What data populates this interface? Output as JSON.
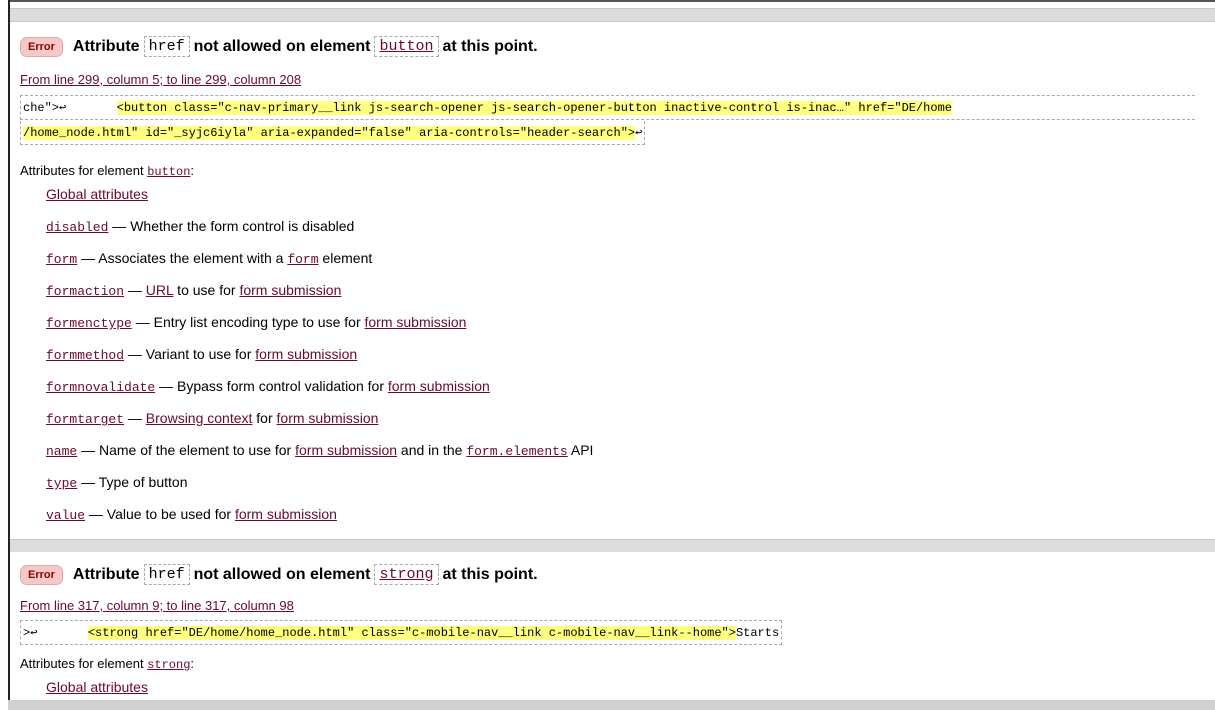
{
  "messages": [
    {
      "badge": "Error",
      "title_pre": "Attribute",
      "attr": "href",
      "title_mid": "not allowed on element",
      "element": "button",
      "title_post": "at this point.",
      "location": "From line 299, column 5; to line 299, column 208",
      "extract_line1_prefix": "che\">↩       ",
      "extract_line1_hl": "<button class=\"c-nav-primary__link js-search-opener js-search-opener-button inactive-control is-inac…\" href=\"DE/home",
      "extract_line2_hl": "/home_node.html\" id=\"_syjc6iyla\" aria-expanded=\"false\" aria-controls=\"header-search\">",
      "extract_line2_suffix": "↩",
      "attrs_heading": "Attributes for element",
      "attrs_element": "button",
      "attrs_heading_suffix": ":",
      "global_attrs": "Global attributes",
      "rows": [
        {
          "name": "disabled",
          "desc1": " — Whether the form control is disabled"
        },
        {
          "name": "form",
          "desc1": " — Associates the element with a ",
          "code": "form",
          "desc2": " element"
        },
        {
          "name": "formaction",
          "desc1": " — ",
          "link1": "URL",
          "desc2": " to use for ",
          "link2": "form submission"
        },
        {
          "name": "formenctype",
          "desc1": " — Entry list encoding type to use for ",
          "link1": "form submission"
        },
        {
          "name": "formmethod",
          "desc1": " — Variant to use for ",
          "link1": "form submission"
        },
        {
          "name": "formnovalidate",
          "desc1": " — Bypass form control validation for ",
          "link1": "form submission"
        },
        {
          "name": "formtarget",
          "desc1": " — ",
          "link1": "Browsing context",
          "desc2": " for ",
          "link2": "form submission"
        },
        {
          "name": "name",
          "desc1": " — Name of the element to use for ",
          "link1": "form submission",
          "desc2": " and in the ",
          "code": "form.elements",
          "desc3": " API"
        },
        {
          "name": "type",
          "desc1": " — Type of button"
        },
        {
          "name": "value",
          "desc1": " — Value to be used for ",
          "link1": "form submission"
        }
      ]
    },
    {
      "badge": "Error",
      "title_pre": "Attribute",
      "attr": "href",
      "title_mid": "not allowed on element",
      "element": "strong",
      "title_post": "at this point.",
      "location": "From line 317, column 9; to line 317, column 98",
      "extract_line1_prefix": ">↩       ",
      "extract_line1_hl": "<strong href=\"DE/home/home_node.html\" class=\"c-mobile-nav__link c-mobile-nav__link--home\">",
      "extract_line1_suffix": "Starts",
      "attrs_heading": "Attributes for element",
      "attrs_element": "strong",
      "attrs_heading_suffix": ":",
      "global_attrs": "Global attributes"
    }
  ]
}
